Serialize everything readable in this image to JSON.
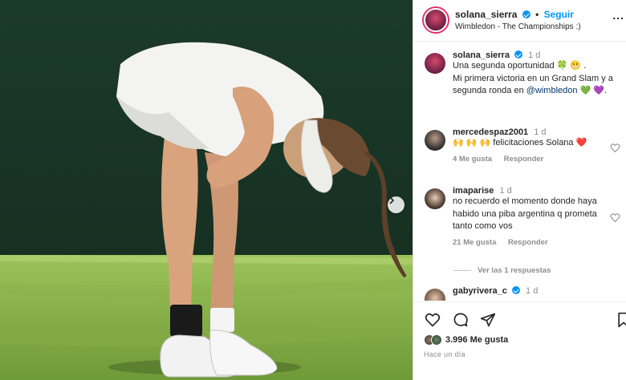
{
  "post": {
    "username": "solana_sierra",
    "follow_label": "Seguir",
    "location": "Wimbledon - The Championships :)",
    "more_label": "..."
  },
  "caption": {
    "username": "solana_sierra",
    "time": "1 d",
    "line1": "Una segunda oportunidad 🍀 😬 .",
    "line2": "Mi primera victoria en un Grand Slam y a segunda ronda en ",
    "mention": "@wimbledon",
    "line2_end": " 💚 💜."
  },
  "comments": [
    {
      "username": "mercedespaz2001",
      "time": "1 d",
      "text": "🙌 🙌 🙌 felicitaciones Solana ❤️",
      "likes": "4 Me gusta",
      "reply": "Responder"
    },
    {
      "username": "imaparise",
      "time": "1 d",
      "text": "no recuerdo el momento donde haya habido una piba argentina q prometa tanto como vos",
      "likes": "21 Me gusta",
      "reply": "Responder",
      "view_replies": "Ver las 1 respuestas"
    },
    {
      "username": "gabyrivera_c",
      "time": "1 d"
    }
  ],
  "footer": {
    "likes_count": "3.996 Me gusta",
    "time_ago": "Hace un día"
  },
  "colors": {
    "accent": "#0095f6",
    "text": "#262626",
    "muted": "#8e8e8e",
    "grass": "#7fa642",
    "backdrop": "#1f3a2b"
  },
  "icons": {
    "like": "heart-icon",
    "comment": "comment-icon",
    "share": "share-icon",
    "save": "bookmark-icon",
    "next": "chevron-right-icon"
  }
}
